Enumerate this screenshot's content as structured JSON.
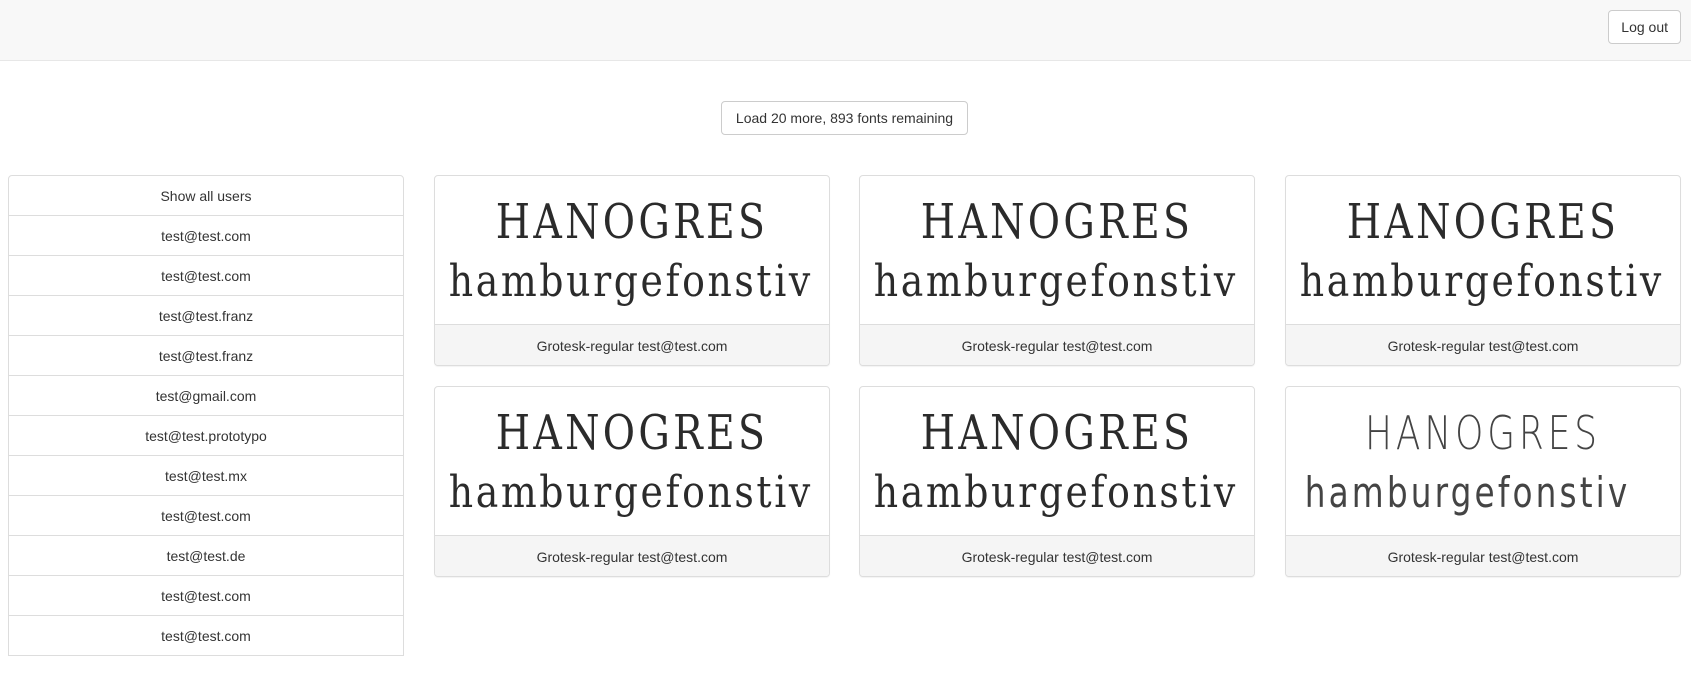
{
  "navbar": {
    "logout_label": "Log out"
  },
  "load_more": {
    "label": "Load 20 more, 893 fonts remaining"
  },
  "users": [
    "Show all users",
    "test@test.com",
    "test@test.com",
    "test@test.franz",
    "test@test.franz",
    "test@gmail.com",
    "test@test.prototypo",
    "test@test.mx",
    "test@test.com",
    "test@test.de",
    "test@test.com",
    "test@test.com"
  ],
  "fonts": [
    {
      "upper": "HANOGRES",
      "lower": "hamburgefonstiv",
      "caption": "Grotesk-regular test@test.com"
    },
    {
      "upper": "HANOGRES",
      "lower": "hamburgefonstiv",
      "caption": "Grotesk-regular test@test.com"
    },
    {
      "upper": "HANOGRES",
      "lower": "hamburgefonstiv",
      "caption": "Grotesk-regular test@test.com"
    },
    {
      "upper": "HANOGRES",
      "lower": "hamburgefonstiv",
      "caption": "Grotesk-regular test@test.com"
    },
    {
      "upper": "HANOGRES",
      "lower": "hamburgefonstiv",
      "caption": "Grotesk-regular test@test.com"
    },
    {
      "upper": "HANOGRES",
      "lower": "hamburgefonstiv",
      "caption": "Grotesk-regular test@test.com"
    }
  ]
}
